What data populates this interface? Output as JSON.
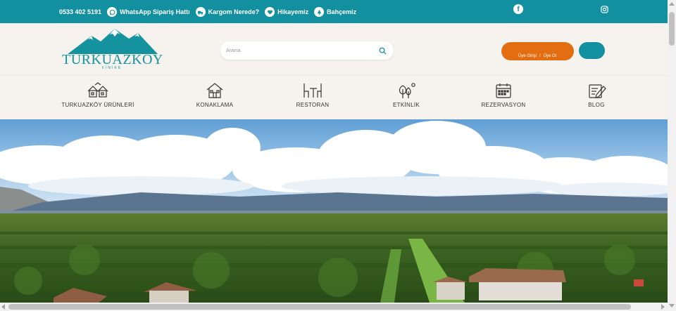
{
  "topbar": {
    "phone": "0533 402 5191",
    "links": [
      {
        "label": "WhatsApp Sipariş Hattı",
        "icon": "whatsapp-icon"
      },
      {
        "label": "Kargom Nerede?",
        "icon": "truck-icon"
      },
      {
        "label": "Hikayemiz",
        "icon": "heart-icon"
      },
      {
        "label": "Bahçemiz",
        "icon": "tree-icon"
      }
    ],
    "social": [
      {
        "icon": "facebook-icon",
        "glyph": "f"
      },
      {
        "icon": "instagram-icon"
      }
    ],
    "color": "#13909f"
  },
  "logo": {
    "name": "TURKUAZKÖY",
    "sub": "FİNİKE"
  },
  "search": {
    "placeholder": "Arama",
    "icon": "search-icon"
  },
  "account": {
    "login": "Üye Girişi",
    "separator": "/",
    "register": "Üye Ol",
    "color": "#e36e11"
  },
  "nav": {
    "items": [
      {
        "label": "TURKUAZKÖY ÜRÜNLERİ",
        "icon": "houses-icon"
      },
      {
        "label": "KONAKLAMA",
        "icon": "house-icon"
      },
      {
        "label": "RESTORAN",
        "icon": "table-icon"
      },
      {
        "label": "ETKİNLİK",
        "icon": "trees-icon"
      },
      {
        "label": "REZERVASYON",
        "icon": "calendar-icon"
      },
      {
        "label": "BLOG",
        "icon": "edit-icon"
      }
    ]
  },
  "hero": {
    "alt_icon": "orchard-landscape-image"
  }
}
